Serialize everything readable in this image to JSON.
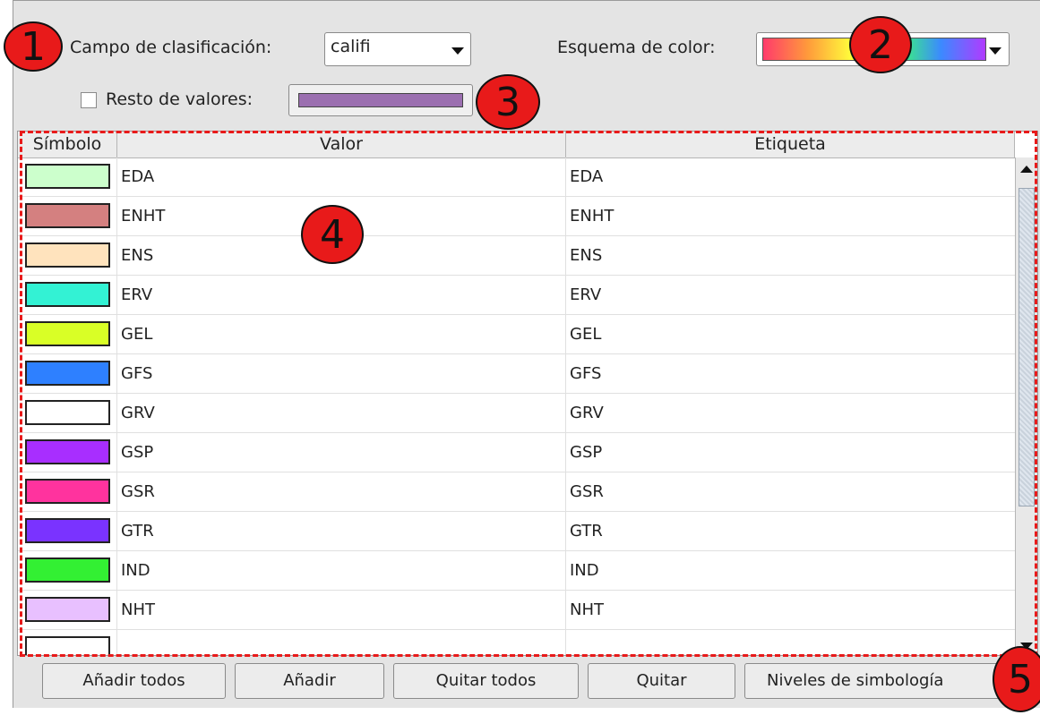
{
  "header": {
    "classification_label": "Campo de clasificación:",
    "classification_value": "califi",
    "color_scheme_label": "Esquema de color:",
    "rest_label": "Resto de valores:"
  },
  "colors": {
    "rest_swatch": "#9b6fb0",
    "scheme_gradient": [
      "#ff3b6b",
      "#ff9a3b",
      "#ffff3b",
      "#3bff6b",
      "#3b8aff",
      "#b03bff"
    ]
  },
  "table": {
    "columns": [
      "Símbolo",
      "Valor",
      "Etiqueta"
    ],
    "rows": [
      {
        "color": "#ccffcc",
        "value": "EDA",
        "label": "EDA"
      },
      {
        "color": "#d48080",
        "value": "ENHT",
        "label": "ENHT"
      },
      {
        "color": "#ffe3bd",
        "value": "ENS",
        "label": "ENS"
      },
      {
        "color": "#33f2d4",
        "value": "ERV",
        "label": "ERV"
      },
      {
        "color": "#d9ff26",
        "value": "GEL",
        "label": "GEL"
      },
      {
        "color": "#2e80ff",
        "value": "GFS",
        "label": "GFS"
      },
      {
        "color": "#ffffff",
        "value": "GRV",
        "label": "GRV"
      },
      {
        "color": "#a82eff",
        "value": "GSP",
        "label": "GSP"
      },
      {
        "color": "#ff339e",
        "value": "GSR",
        "label": "GSR"
      },
      {
        "color": "#7a33ff",
        "value": "GTR",
        "label": "GTR"
      },
      {
        "color": "#33f033",
        "value": "IND",
        "label": "IND"
      },
      {
        "color": "#e8c0ff",
        "value": "NHT",
        "label": "NHT"
      }
    ]
  },
  "buttons": {
    "add_all": "Añadir todos",
    "add": "Añadir",
    "remove_all": "Quitar todos",
    "remove": "Quitar",
    "levels": "Niveles de simbología"
  },
  "badges": [
    "1",
    "2",
    "3",
    "4",
    "5"
  ]
}
